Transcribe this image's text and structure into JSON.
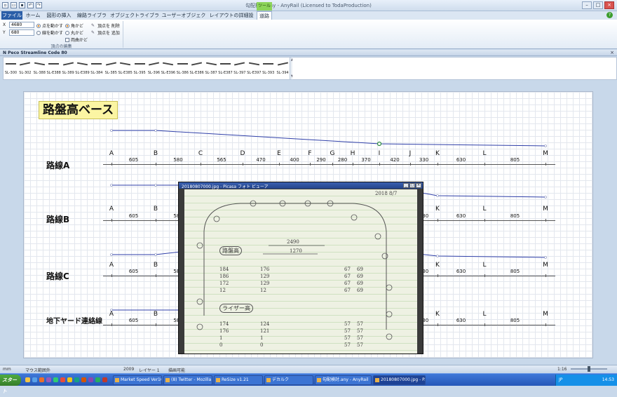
{
  "window": {
    "title": "勾配検討.any - AnyRail (Licensed to TodaProduction)",
    "context_tab": "ツール"
  },
  "ribbon": {
    "tabs": [
      "ファイル",
      "ホーム",
      "図形の挿入",
      "線路ライブラリ",
      "オブジェクトライブラリ",
      "ユーザーオブジェクト",
      "レイアウトの詳細設定",
      "道路"
    ],
    "x_label": "X",
    "x_value": "4680",
    "y_label": "Y",
    "y_value": "680",
    "options": [
      "点を動かす",
      "線を動かす",
      "角かど",
      "丸かど",
      "両曲かど"
    ],
    "vertex_delete": "頂点を 削除",
    "vertex_add": "頂点を 追加",
    "group_label": "頂点の編集"
  },
  "library": {
    "title": "N Peco Streamline Code 80",
    "items": [
      "SL-300",
      "SL-302",
      "SL-388",
      "SL-E388",
      "SL-389",
      "SL-E389",
      "SL-384",
      "SL-385",
      "SL-E385",
      "SL-395",
      "SL-396",
      "SL-E396",
      "SL-386",
      "SL-E386",
      "SL-387",
      "SL-E387",
      "SL-397",
      "SL-E397",
      "SL-393",
      "SL-394"
    ]
  },
  "canvas": {
    "title": "路盤高ベース",
    "stations": [
      "A",
      "B",
      "C",
      "D",
      "E",
      "F",
      "G",
      "H",
      "I",
      "J",
      "K",
      "L",
      "M"
    ],
    "distances": [
      "605",
      "580",
      "565",
      "470",
      "400",
      "290",
      "280",
      "370",
      "420",
      "330",
      "630",
      "805"
    ],
    "routes": [
      {
        "label": "路線A"
      },
      {
        "label": "路線B"
      },
      {
        "label": "路線C"
      },
      {
        "label": "地下ヤード連絡線"
      }
    ]
  },
  "popup": {
    "title": "20180807000.jpg - Picasa フォト ビューア",
    "note_date": "2018 8/7",
    "note_h1": "路盤高",
    "note_h2": "ライザー高",
    "note_dim": "2490",
    "note_dim2": "1270",
    "rows1": [
      [
        "184",
        "176",
        "67",
        "69"
      ],
      [
        "186",
        "129",
        "67",
        "69"
      ],
      [
        "172",
        "129",
        "67",
        "69"
      ],
      [
        "12",
        "12",
        "67",
        "69"
      ]
    ],
    "rows2": [
      [
        "174",
        "124",
        "57",
        "57"
      ],
      [
        "176",
        "121",
        "57",
        "57"
      ],
      [
        "1",
        "1",
        "57",
        "57"
      ],
      [
        "0",
        "0",
        "57",
        "57"
      ]
    ]
  },
  "status": {
    "mm": "mm",
    "mouse": "マウス範囲外",
    "count": "2009",
    "layer": "レイヤー 1",
    "mode": "描画可能",
    "scale": "1:16"
  },
  "taskbar": {
    "start": "スタート",
    "tasks": [
      "Market Speed Ver16.2",
      "(8) Twitter - Mozilla Fir...",
      "ReSize v1.21",
      "デカルク",
      "勾配検討.any - AnyRail",
      "20180807000.jpg - P..."
    ],
    "lang": "JP",
    "time": "14:53"
  },
  "colors": {
    "profile_line": "#2f3fa8",
    "accent": "#2a5ea8",
    "label_bg": "#fbf5a3"
  }
}
